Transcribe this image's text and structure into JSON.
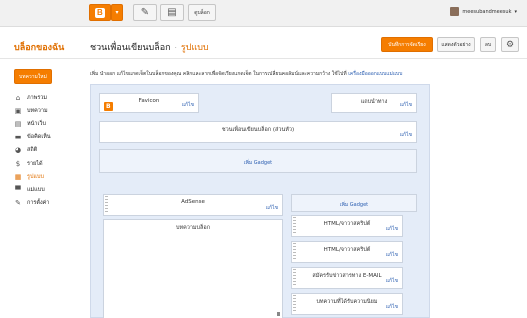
{
  "topbar": {
    "view_blog_label": "ดูบล็อก",
    "user_name": "meesubandmeesuk",
    "caret": "▾",
    "user_caret": "▾"
  },
  "header": {
    "brand": "บล็อกของฉัน",
    "crumb_parent": "ชวนเพื่อนเขียนบล็อก",
    "crumb_sep": "·",
    "crumb_current": "รูปแบบ",
    "save_label": "บันทึกการจัดเรียง",
    "preview_label": "แสดงตัวอย่าง",
    "clear_label": "ลบ"
  },
  "sidebar": {
    "new_post_label": "บทความใหม่",
    "items": [
      {
        "label": "ภาพรวม",
        "icon": "home-icon"
      },
      {
        "label": "บทความ",
        "icon": "posts-icon"
      },
      {
        "label": "หน้าเว็บ",
        "icon": "pages-icon"
      },
      {
        "label": "ข้อคิดเห็น",
        "icon": "comments-icon"
      },
      {
        "label": "สถิติ",
        "icon": "stats-icon"
      },
      {
        "label": "รายได้",
        "icon": "earnings-icon"
      },
      {
        "label": "รูปแบบ",
        "icon": "layout-icon",
        "active": true
      },
      {
        "label": "แม่แบบ",
        "icon": "template-icon"
      },
      {
        "label": "การตั้งค่า",
        "icon": "settings-icon"
      }
    ]
  },
  "description": {
    "text": "เพิ่ม นำออก แก้ไขแกดเจ็ตในบล็อกของคุณ คลิกและลากเพื่อจัดเรียงแกดเจ็ต ในการเปลี่ยนคอลัมน์และความกว้าง ใช้ไปที่",
    "link": "เครื่องมือออกแบบแม่แบบ"
  },
  "layout": {
    "favicon": {
      "title": "Favicon",
      "edit": "แก้ไข"
    },
    "navbar": {
      "title": "แถบนำทาง",
      "edit": "แก้ไข"
    },
    "header_box": {
      "title": "ชวนเพื่อนเขียนบล็อก (ส่วนหัว)",
      "edit": "แก้ไข"
    },
    "add_gadget_top": "เพิ่ม Gadget",
    "adsense": {
      "title": "AdSense",
      "edit": "แก้ไข"
    },
    "add_gadget_side": "เพิ่ม Gadget",
    "blog_posts": {
      "title": "บทความบล็อก"
    },
    "side_gadgets": [
      {
        "title": "HTML/จาวาสคริปต์",
        "edit": "แก้ไข"
      },
      {
        "title": "HTML/จาวาสคริปต์",
        "edit": "แก้ไข"
      },
      {
        "title": "สมัครรับข่าวสารทาง E-MAIL",
        "edit": "แก้ไข"
      },
      {
        "title": "บทความที่ได้รับความนิยม",
        "edit": "แก้ไข"
      }
    ]
  },
  "colors": {
    "accent": "#f57d00",
    "link": "#2a5db0",
    "canvas_bg": "#e4ecf8"
  }
}
